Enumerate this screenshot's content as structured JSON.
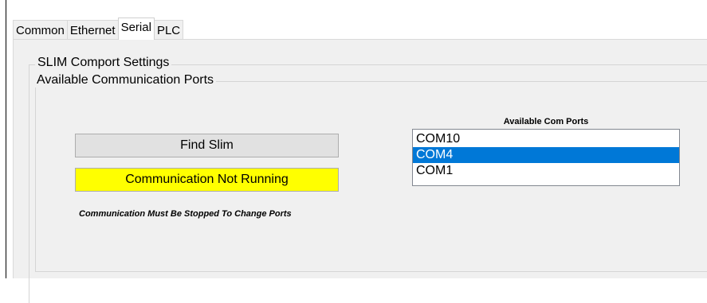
{
  "tabs": [
    {
      "label": "Common",
      "active": false
    },
    {
      "label": "Ethernet",
      "active": false
    },
    {
      "label": "Serial",
      "active": true
    },
    {
      "label": "PLC",
      "active": false
    }
  ],
  "groups": {
    "outer_title": "SLIM Comport Settings",
    "inner_title": "Available Communication Ports"
  },
  "buttons": {
    "find_slim": "Find Slim",
    "communication_status": "Communication Not Running"
  },
  "note": "Communication Must Be Stopped To Change Ports",
  "com_ports": {
    "title": "Available Com Ports",
    "items": [
      "COM10",
      "COM4",
      "COM1"
    ],
    "selected": "COM4"
  },
  "colors": {
    "status_background": "#ffff00",
    "selection": "#0078d7"
  }
}
